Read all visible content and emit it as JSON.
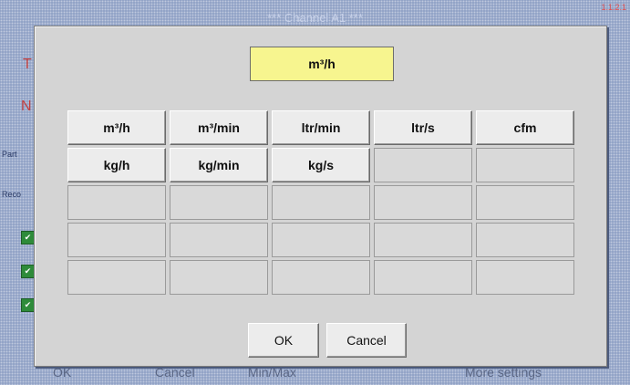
{
  "background": {
    "title": "*** Channel A1 ***",
    "corner_text": "1.1.2.1",
    "side_letters": [
      "T",
      "N"
    ],
    "side_labels": [
      "Part",
      "Reco"
    ],
    "bottom_labels": [
      "OK",
      "Cancel",
      "Min/Max",
      "More settings"
    ]
  },
  "dialog": {
    "selected_unit": "m³/h",
    "units": [
      "m³/h",
      "m³/min",
      "ltr/min",
      "ltr/s",
      "cfm",
      "kg/h",
      "kg/min",
      "kg/s"
    ],
    "ok_label": "OK",
    "cancel_label": "Cancel"
  },
  "colors": {
    "selected_bg": "#f7f58f",
    "dialog_bg": "#d4d4d4",
    "check_green": "#2e8b3a"
  }
}
